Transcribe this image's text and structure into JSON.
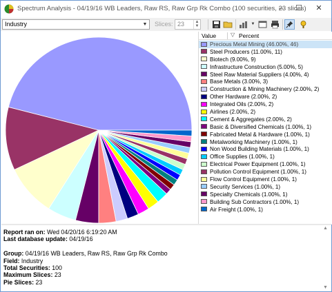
{
  "window": {
    "title": "Spectrum Analysis - 04/19/16 WB  Leaders, Raw RS, Raw Grp Rk Combo (100 securities, 23 slices)",
    "controls": [
      "–",
      "☐",
      "✕"
    ]
  },
  "toolbar": {
    "field_value": "Industry",
    "slices_label": "Slices:",
    "slices_value": "23"
  },
  "legend": {
    "header_value": "Value",
    "header_sort": "▽",
    "header_percent": "Percent",
    "items": [
      {
        "label": "Precious Metal Mining (46.00%, 46)",
        "color": "#9999ff"
      },
      {
        "label": "Steel Producers (11.00%, 11)",
        "color": "#993366"
      },
      {
        "label": "Biotech (9.00%, 9)",
        "color": "#ffffcc"
      },
      {
        "label": "Infrastructure Construction (5.00%, 5)",
        "color": "#ccffff"
      },
      {
        "label": "Steel Raw Material Suppliers (4.00%, 4)",
        "color": "#660066"
      },
      {
        "label": "Base Metals (3.00%, 3)",
        "color": "#ff8080"
      },
      {
        "label": "Construction & Mining Machinery (2.00%, 2)",
        "color": "#ccccff"
      },
      {
        "label": "Other Hardware (2.00%, 2)",
        "color": "#000080"
      },
      {
        "label": "Integrated Oils (2.00%, 2)",
        "color": "#ff00ff"
      },
      {
        "label": "Airlines (2.00%, 2)",
        "color": "#ffff00"
      },
      {
        "label": "Cement & Aggregates (2.00%, 2)",
        "color": "#00ffff"
      },
      {
        "label": "Basic & Diversified Chemicals (1.00%, 1)",
        "color": "#800080"
      },
      {
        "label": "Fabricated Metal & Hardware (1.00%, 1)",
        "color": "#800000"
      },
      {
        "label": "Metalworking Machinery (1.00%, 1)",
        "color": "#008080"
      },
      {
        "label": "Non Wood Building Materials (1.00%, 1)",
        "color": "#0000ff"
      },
      {
        "label": "Office Supplies (1.00%, 1)",
        "color": "#00ccff"
      },
      {
        "label": "Electrical Power Equipment (1.00%, 1)",
        "color": "#ccffcc"
      },
      {
        "label": "Pollution Control Equipment (1.00%, 1)",
        "color": "#993366"
      },
      {
        "label": "Flow Control Equipment (1.00%, 1)",
        "color": "#ffff99"
      },
      {
        "label": "Security Services (1.00%, 1)",
        "color": "#99ccff"
      },
      {
        "label": "Specialty Chemicals (1.00%, 1)",
        "color": "#660066"
      },
      {
        "label": "Building Sub Contractors (1.00%, 1)",
        "color": "#ff99cc"
      },
      {
        "label": "Air Freight (1.00%, 1)",
        "color": "#0066cc"
      }
    ]
  },
  "chart_data": {
    "type": "pie",
    "categories": [
      "Precious Metal Mining",
      "Steel Producers",
      "Biotech",
      "Infrastructure Construction",
      "Steel Raw Material Suppliers",
      "Base Metals",
      "Construction & Mining Machinery",
      "Other Hardware",
      "Integrated Oils",
      "Airlines",
      "Cement & Aggregates",
      "Basic & Diversified Chemicals",
      "Fabricated Metal & Hardware",
      "Metalworking Machinery",
      "Non Wood Building Materials",
      "Office Supplies",
      "Electrical Power Equipment",
      "Pollution Control Equipment",
      "Flow Control Equipment",
      "Security Services",
      "Specialty Chemicals",
      "Building Sub Contractors",
      "Air Freight"
    ],
    "values": [
      46,
      11,
      9,
      5,
      4,
      3,
      2,
      2,
      2,
      2,
      2,
      1,
      1,
      1,
      1,
      1,
      1,
      1,
      1,
      1,
      1,
      1,
      1
    ],
    "colors": [
      "#9999ff",
      "#993366",
      "#ffffcc",
      "#ccffff",
      "#660066",
      "#ff8080",
      "#ccccff",
      "#000080",
      "#ff00ff",
      "#ffff00",
      "#00ffff",
      "#800080",
      "#800000",
      "#008080",
      "#0000ff",
      "#00ccff",
      "#ccffcc",
      "#993366",
      "#ffff99",
      "#99ccff",
      "#660066",
      "#ff99cc",
      "#0066cc"
    ],
    "start_angle_deg": 0,
    "direction": "counterclockwise",
    "slice_border": "#ffffff"
  },
  "info": {
    "report_ran_label": "Report ran on:",
    "report_ran_value": "Wed 04/20/16 6:19:20 AM",
    "last_update_label": "Last database update:",
    "last_update_value": "04/19/16",
    "group_label": "Group:",
    "group_value": "04/19/16 WB  Leaders, Raw RS, Raw Grp Rk Combo",
    "field_label": "Field:",
    "field_value": "Industry",
    "total_label": "Total Securities:",
    "total_value": "100",
    "max_label": "Maximum Slices:",
    "max_value": "23",
    "pie_label": "Pie Slices:",
    "pie_value": "23"
  }
}
